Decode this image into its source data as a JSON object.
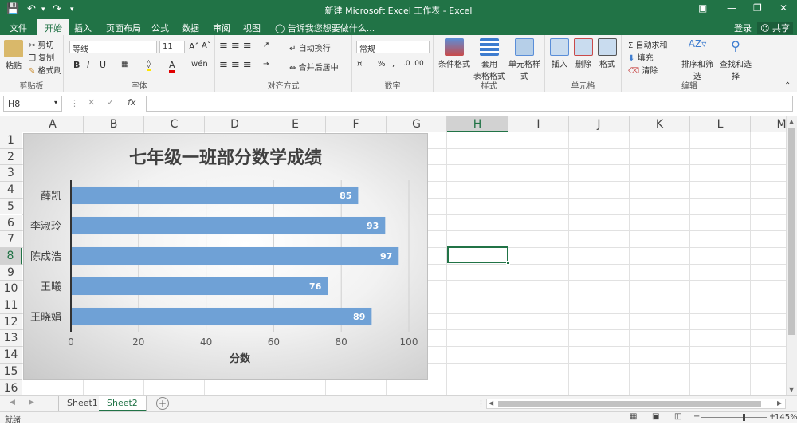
{
  "window": {
    "title": "新建 Microsoft Excel 工作表 - Excel"
  },
  "tabs": {
    "items": [
      "文件",
      "开始",
      "插入",
      "页面布局",
      "公式",
      "数据",
      "审阅",
      "视图"
    ],
    "active": "开始",
    "tell_me": "告诉我您想要做什么...",
    "sign_in": "登录",
    "share": "共享"
  },
  "ribbon": {
    "clipboard": {
      "label": "剪贴板",
      "paste": "粘贴",
      "cut": "剪切",
      "copy": "复制",
      "format_painter": "格式刷"
    },
    "font": {
      "label": "字体",
      "font_name": "等线",
      "font_size": "11",
      "bold": "B",
      "italic": "I",
      "underline": "U"
    },
    "alignment": {
      "label": "对齐方式",
      "wrap": "自动换行",
      "merge": "合并后居中"
    },
    "number": {
      "label": "数字",
      "format": "常规",
      "percent": "%"
    },
    "styles": {
      "label": "样式",
      "conditional": "条件格式",
      "table": "套用\n表格格式",
      "table_line1": "套用",
      "table_line2": "表格格式",
      "cell_styles": "单元格样式"
    },
    "cells": {
      "label": "单元格",
      "insert": "插入",
      "delete": "删除",
      "format": "格式"
    },
    "editing": {
      "label": "编辑",
      "autosum": "自动求和",
      "fill": "填充",
      "clear": "清除",
      "sort": "排序和筛选",
      "find": "查找和选择"
    }
  },
  "formula_bar": {
    "name_box": "H8",
    "fx": "fx",
    "value": ""
  },
  "grid": {
    "columns": [
      "A",
      "B",
      "C",
      "D",
      "E",
      "F",
      "G",
      "H",
      "I",
      "J",
      "K",
      "L",
      "M"
    ],
    "rows": [
      "1",
      "2",
      "3",
      "4",
      "5",
      "6",
      "7",
      "8",
      "9",
      "10",
      "11",
      "12",
      "13",
      "14",
      "15",
      "16"
    ],
    "selected_col": "H",
    "selected_row": "8"
  },
  "chart_data": {
    "type": "bar",
    "orientation": "horizontal",
    "title": "七年级一班部分数学成绩",
    "xlabel": "分数",
    "ylabel": "",
    "categories": [
      "薛凯",
      "李淑玲",
      "陈成浩",
      "王曦",
      "王晓娟"
    ],
    "values": [
      85,
      93,
      97,
      76,
      89
    ],
    "xlim": [
      0,
      100
    ],
    "xticks": [
      "0",
      "20",
      "40",
      "60",
      "80",
      "100"
    ],
    "bar_color": "#6fa1d6",
    "label_color": "#ffffff",
    "grid": true
  },
  "sheets": {
    "items": [
      "Sheet1",
      "Sheet2"
    ],
    "active": "Sheet2",
    "add": "+"
  },
  "status_bar": {
    "ready": "就绪",
    "zoom": "145%",
    "zoom_fraction": 0.64
  },
  "colors": {
    "accent": "#217346",
    "ribbon_bg": "#f3f3f3"
  }
}
